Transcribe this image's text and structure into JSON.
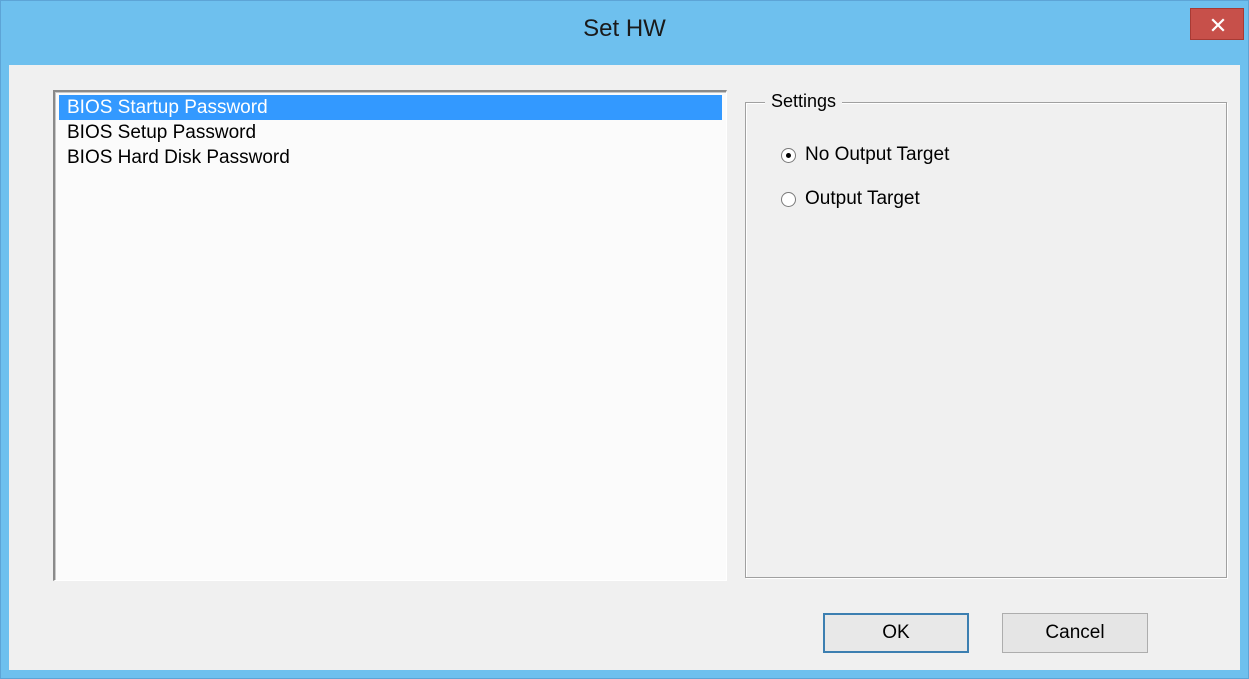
{
  "window": {
    "title": "Set HW"
  },
  "list": {
    "items": [
      {
        "label": "BIOS Startup Password",
        "selected": true
      },
      {
        "label": "BIOS Setup Password",
        "selected": false
      },
      {
        "label": "BIOS Hard Disk Password",
        "selected": false
      }
    ]
  },
  "settings": {
    "legend": "Settings",
    "options": [
      {
        "label": "No Output Target",
        "checked": true
      },
      {
        "label": "Output Target",
        "checked": false
      }
    ]
  },
  "buttons": {
    "ok": "OK",
    "cancel": "Cancel"
  },
  "colors": {
    "titlebar": "#6ec0ee",
    "close": "#c7504a",
    "selection": "#3399ff"
  },
  "icons": {
    "close": "close-icon"
  }
}
